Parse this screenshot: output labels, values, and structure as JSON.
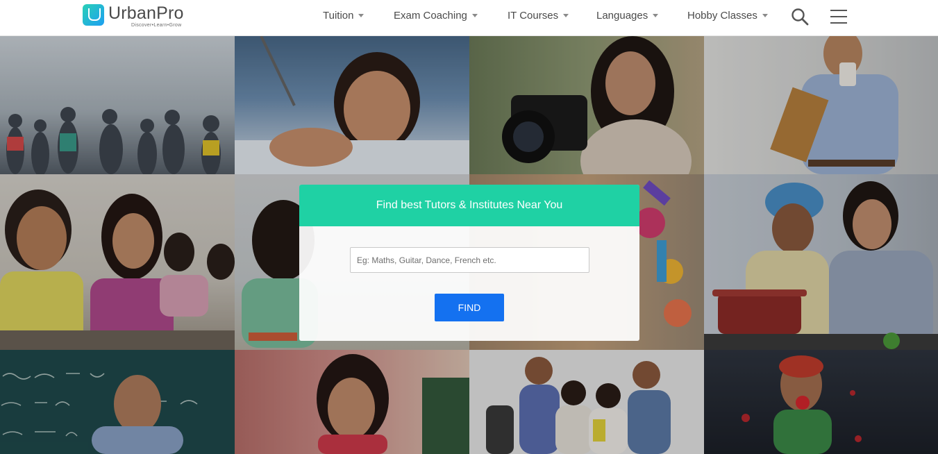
{
  "brand": {
    "name": "UrbanPro",
    "tagline": "Discover•Learn•Grow",
    "accent": "#1fd1a4",
    "button_color": "#1471f0"
  },
  "nav": {
    "items": [
      {
        "label": "Tuition"
      },
      {
        "label": "Exam Coaching"
      },
      {
        "label": "IT Courses"
      },
      {
        "label": "Languages"
      },
      {
        "label": "Hobby Classes"
      }
    ],
    "search_icon": "search-icon",
    "menu_icon": "hamburger-menu-icon"
  },
  "hero": {
    "heading": "Find best Tutors & Institutes Near You",
    "search_placeholder": "Eg: Maths, Guitar, Dance, French etc.",
    "search_value": "",
    "find_label": "FIND"
  }
}
